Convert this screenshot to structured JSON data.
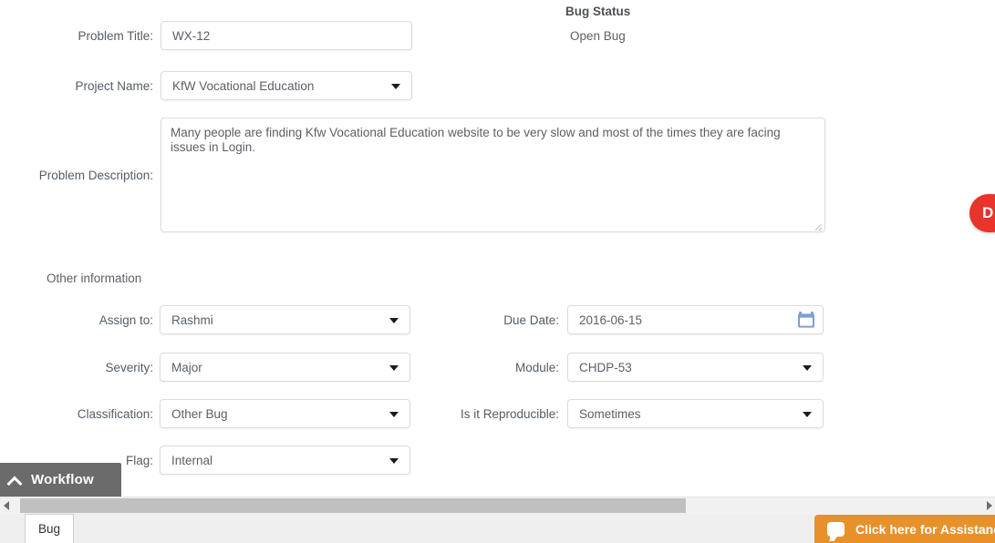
{
  "bug_status": {
    "title": "Bug Status",
    "value": "Open Bug"
  },
  "fields": {
    "problem_title": {
      "label": "Problem Title:",
      "value": "WX-12"
    },
    "project_name": {
      "label": "Project Name:",
      "value": "KfW Vocational Education"
    },
    "problem_description": {
      "label": "Problem Description:",
      "value": "Many people are finding Kfw Vocational Education website to be very slow and most of the times they are facing issues in Login."
    },
    "assign_to": {
      "label": "Assign to:",
      "value": "Rashmi"
    },
    "severity": {
      "label": "Severity:",
      "value": "Major"
    },
    "classification": {
      "label": "Classification:",
      "value": "Other Bug"
    },
    "flag": {
      "label": "Flag:",
      "value": "Internal"
    },
    "due_date": {
      "label": "Due Date:",
      "value": "2016-06-15"
    },
    "module": {
      "label": "Module:",
      "value": "CHDP-53"
    },
    "is_reproducible": {
      "label": "Is it Reproducible:",
      "value": "Sometimes"
    }
  },
  "section": {
    "other_information": "Other information"
  },
  "workflow_tab": {
    "label": "Workflow"
  },
  "bottom": {
    "bug_tab": "Bug"
  },
  "assistance": {
    "label": "Click here for Assistance"
  },
  "side_tab": {
    "label": "D"
  },
  "colors": {
    "workflow_tab_bg": "#6b6b6b",
    "assistance_bg": "#e8912a",
    "side_tab_bg": "#e8342a",
    "calendar_icon": "#7d9fd3",
    "field_border": "#dcdcdc",
    "label_text": "#555c63"
  }
}
